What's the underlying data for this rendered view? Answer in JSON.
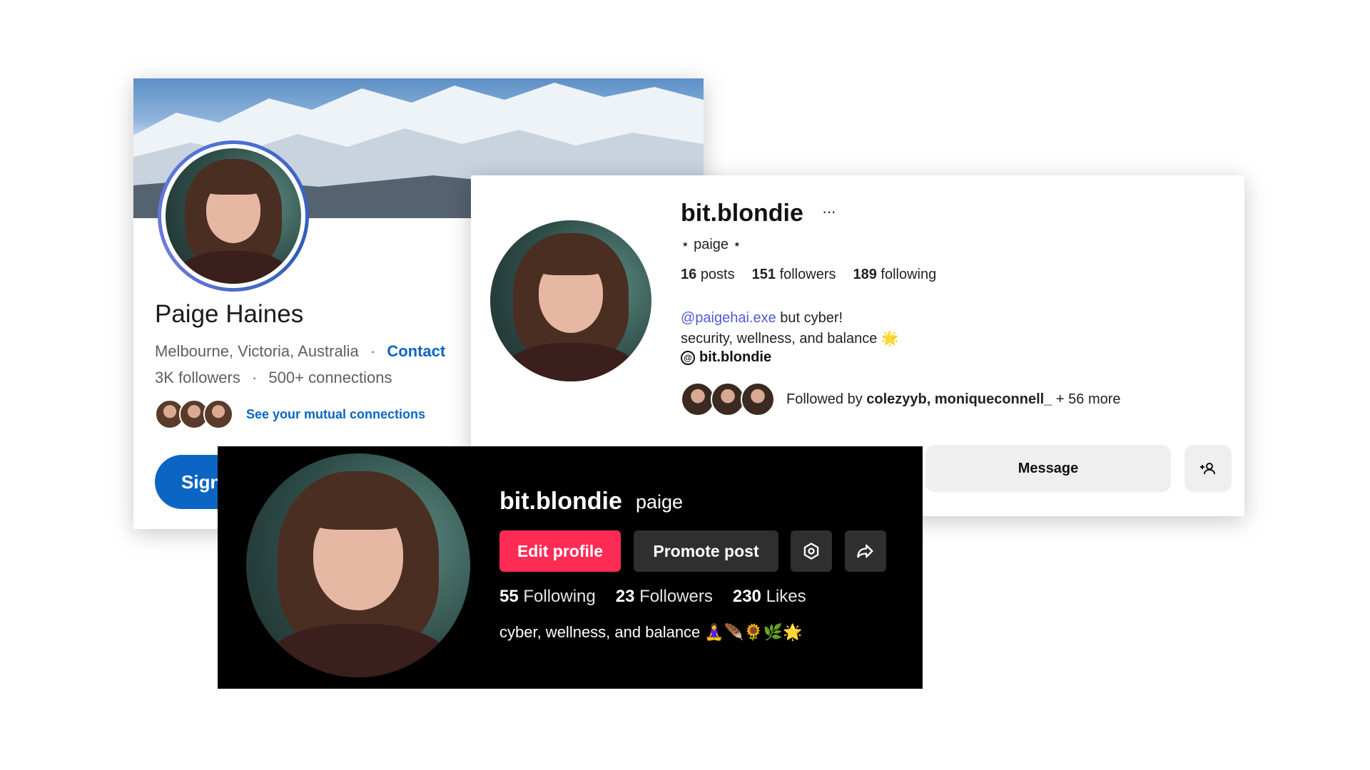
{
  "linkedin": {
    "name": "Paige Haines",
    "location": "Melbourne, Victoria, Australia",
    "separator": "·",
    "contact_label": "Contact",
    "followers": "3K followers",
    "connections": "500+ connections",
    "mutual_link": "See your mutual connections",
    "signin_label": "Sign",
    "accent": "#0a66c2"
  },
  "instagram": {
    "username": "bit.blondie",
    "more_icon": "ellipsis-icon",
    "display_name": "⋆ paige ⋆",
    "stats": {
      "posts_count": "16",
      "posts_label": "posts",
      "followers_count": "151",
      "followers_label": "followers",
      "following_count": "189",
      "following_label": "following"
    },
    "bio_mention": "@paigehai.exe",
    "bio_line1_rest": " but cyber!",
    "bio_line2": "security, wellness, and balance 🌟",
    "threads_handle": "bit.blondie",
    "followed_by_prefix": "Followed by ",
    "followed_by_names": "colezyyb, moniqueconnell_",
    "followed_by_more": " + 56 more",
    "message_label": "Message",
    "add_user_icon": "add-user-icon",
    "mention_color": "#4f5bd5"
  },
  "tiktok": {
    "username": "bit.blondie",
    "nickname": "paige",
    "edit_label": "Edit profile",
    "promote_label": "Promote post",
    "settings_icon": "settings-icon",
    "share_icon": "share-icon",
    "stats": {
      "following_count": "55",
      "following_label": "Following",
      "followers_count": "23",
      "followers_label": "Followers",
      "likes_count": "230",
      "likes_label": "Likes"
    },
    "bio": "cyber, wellness, and balance 🧘‍♀️🪶🌻🌿🌟",
    "accent": "#fe2c55"
  }
}
